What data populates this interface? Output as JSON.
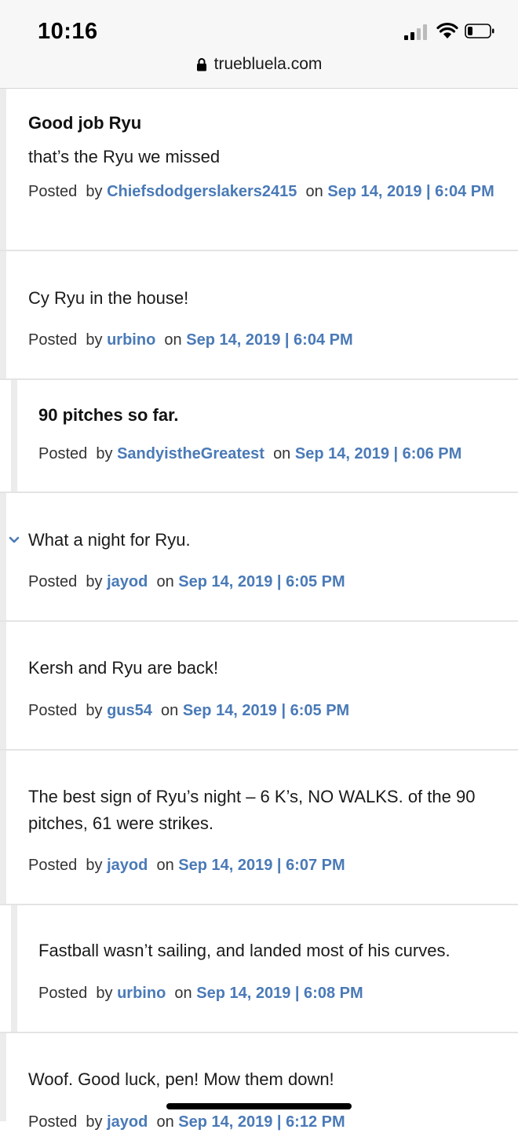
{
  "status": {
    "time": "10:16"
  },
  "browser": {
    "url": "truebluela.com"
  },
  "meta_labels": {
    "posted": "Posted",
    "by": "by",
    "on": "on"
  },
  "comments": [
    {
      "title": "Good job Ryu",
      "body": "that’s the Ryu we missed",
      "user": "Chiefsdodgerslakers2415",
      "date": "Sep 14, 2019 | 6:04 PM"
    },
    {
      "title": "",
      "body": "Cy Ryu in the house!",
      "user": "urbino",
      "date": "Sep 14, 2019 | 6:04 PM"
    },
    {
      "title": "90 pitches so far.",
      "body": "",
      "user": "SandyistheGreatest",
      "date": "Sep 14, 2019 | 6:06 PM"
    },
    {
      "title": "",
      "body": "What a night for Ryu.",
      "user": "jayod",
      "date": "Sep 14, 2019 | 6:05 PM"
    },
    {
      "title": "",
      "body": "Kersh and Ryu are back!",
      "user": "gus54",
      "date": "Sep 14, 2019 | 6:05 PM"
    },
    {
      "title": "",
      "body": "The best sign of Ryu’s night – 6 K’s, NO WALKS. of the 90 pitches, 61 were strikes.",
      "user": "jayod",
      "date": "Sep 14, 2019 | 6:07 PM"
    },
    {
      "title": "",
      "body": "Fastball wasn’t sailing, and landed most of his curves.",
      "user": "urbino",
      "date": "Sep 14, 2019 | 6:08 PM"
    },
    {
      "title": "",
      "body": "Woof. Good luck, pen! Mow them down!",
      "user": "jayod",
      "date": "Sep 14, 2019 | 6:12 PM"
    }
  ]
}
